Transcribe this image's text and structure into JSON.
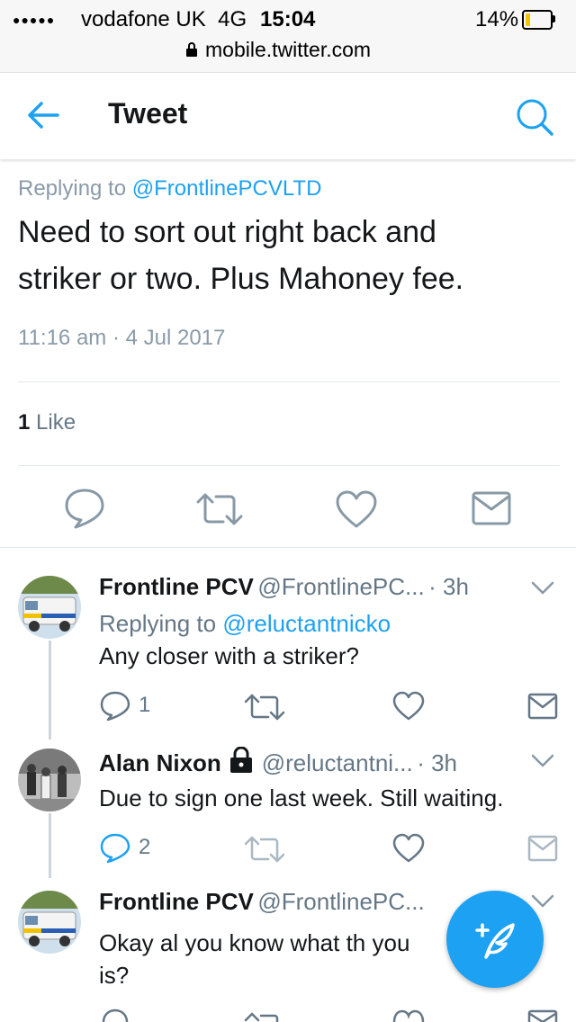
{
  "status_bar": {
    "signal": "●●●●●",
    "carrier": "vodafone UK",
    "network": "4G",
    "time": "15:04",
    "battery": "14%",
    "url": "mobile.twitter.com"
  },
  "header": {
    "title": "Tweet",
    "back_icon": "arrow-left-icon",
    "search_icon": "search-icon"
  },
  "main_tweet": {
    "replying_prefix": "Replying to ",
    "replying_handle": "@FrontlinePCVLTD",
    "text_line1": "Need to sort out right back and",
    "text_line2": "striker or two. Plus Mahoney fee.",
    "timestamp": "11:16 am · 4 Jul 2017",
    "likes_count": "1",
    "likes_label": " Like"
  },
  "replies": [
    {
      "name": "Frontline PCV",
      "handle": "@FrontlinePC...",
      "time": "· 3h",
      "replying_prefix": "Replying to ",
      "replying_handle": "@reluctantnicko",
      "text": "Any closer with a striker?",
      "reply_count": "1"
    },
    {
      "name": "Alan Nixon",
      "handle": "@reluctantni...",
      "time": "· 3h",
      "text": "Due to sign one last week. Still waiting.",
      "reply_count": "2"
    },
    {
      "name": "Frontline PCV",
      "handle": "@FrontlinePC...",
      "text_line1": "Okay al you know what th you",
      "text_line2": "is?"
    }
  ],
  "colors": {
    "accent": "#1da1f2",
    "icon_gray": "#8899a6",
    "text_secondary": "#657786"
  }
}
